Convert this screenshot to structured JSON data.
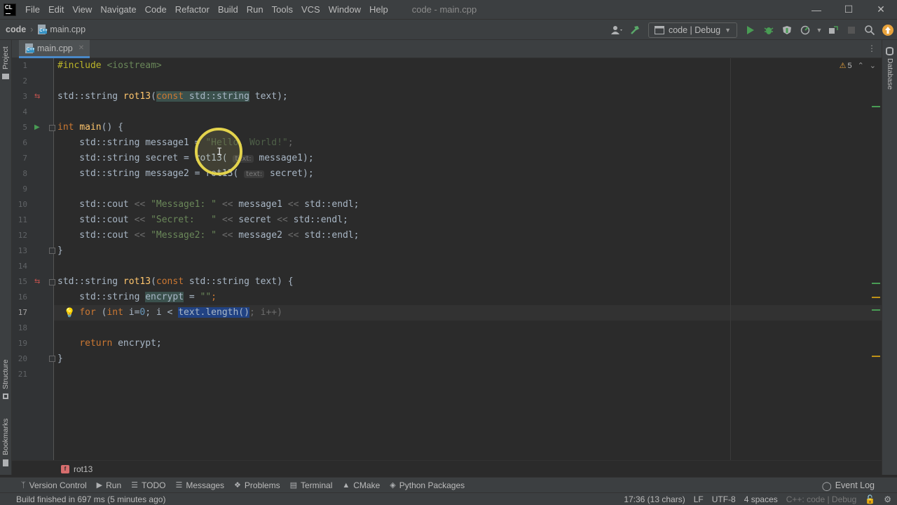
{
  "menu": {
    "logo": "CL",
    "items": [
      "File",
      "Edit",
      "View",
      "Navigate",
      "Code",
      "Refactor",
      "Build",
      "Run",
      "Tools",
      "VCS",
      "Window",
      "Help"
    ],
    "window_title": "code - main.cpp",
    "minimize_icon": "minimize-icon",
    "maximize_icon": "maximize-icon",
    "close_icon": "close-icon"
  },
  "navbar": {
    "project": "code",
    "file": "main.cpp",
    "run_config": "code | Debug"
  },
  "sidebar_left": {
    "project_label": "Project",
    "structure_label": "Structure",
    "bookmarks_label": "Bookmarks"
  },
  "sidebar_right": {
    "database_label": "Database"
  },
  "tabs": [
    {
      "label": "main.cpp",
      "active": true
    }
  ],
  "editor": {
    "inspection_count": "5",
    "current_line": 17,
    "line_numbers": [
      "1",
      "2",
      "3",
      "4",
      "5",
      "6",
      "7",
      "8",
      "9",
      "10",
      "11",
      "12",
      "13",
      "14",
      "15",
      "16",
      "17",
      "18",
      "19",
      "20",
      "21"
    ]
  },
  "editor_breadcrumb": {
    "badge": "f",
    "function": "rot13"
  },
  "toolwindows": [
    "Version Control",
    "Run",
    "TODO",
    "Messages",
    "Problems",
    "Terminal",
    "CMake",
    "Python Packages"
  ],
  "event_log": "Event Log",
  "status": {
    "message": "Build finished in 697 ms (5 minutes ago)",
    "position": "17:36 (13 chars)",
    "line_sep": "LF",
    "encoding": "UTF-8",
    "indent": "4 spaces",
    "context": "C++: code | Debug"
  }
}
